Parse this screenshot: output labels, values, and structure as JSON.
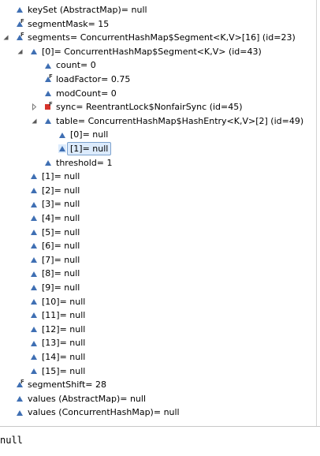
{
  "colors": {
    "field_icon": "#3f6fb3",
    "selection_bg": "#dcebfc",
    "selection_border": "#7da2ce",
    "private_icon": "#d6332b"
  },
  "variables": [
    {
      "label": "keySet (AbstractMap)= null",
      "icon": "field-icon",
      "final": false,
      "twisty": "none"
    },
    {
      "label": "segmentMask= 15",
      "icon": "field-icon",
      "final": true,
      "twisty": "none"
    },
    {
      "label": "segments= ConcurrentHashMap$Segment<K,V>[16]  (id=23)",
      "icon": "field-icon",
      "final": true,
      "twisty": "expanded"
    },
    {
      "label": "[0]= ConcurrentHashMap$Segment<K,V>  (id=43)",
      "icon": "field-icon",
      "final": false,
      "twisty": "expanded"
    },
    {
      "label": "count= 0",
      "icon": "field-icon",
      "final": false,
      "twisty": "none"
    },
    {
      "label": "loadFactor= 0.75",
      "icon": "field-icon",
      "final": true,
      "twisty": "none"
    },
    {
      "label": "modCount= 0",
      "icon": "field-icon",
      "final": false,
      "twisty": "none"
    },
    {
      "label": "sync= ReentrantLock$NonfairSync  (id=45)",
      "icon": "private-field-icon",
      "final": true,
      "twisty": "collapsed"
    },
    {
      "label": "table= ConcurrentHashMap$HashEntry<K,V>[2]  (id=49)",
      "icon": "field-icon",
      "final": false,
      "twisty": "expanded"
    },
    {
      "label": "[0]= null",
      "icon": "field-icon",
      "final": false,
      "twisty": "none"
    },
    {
      "label": "[1]= null",
      "icon": "field-icon",
      "final": false,
      "twisty": "none",
      "selected": true
    },
    {
      "label": "threshold= 1",
      "icon": "field-icon",
      "final": false,
      "twisty": "none"
    },
    {
      "label": "[1]= null",
      "icon": "field-icon",
      "final": false,
      "twisty": "none"
    },
    {
      "label": "[2]= null",
      "icon": "field-icon",
      "final": false,
      "twisty": "none"
    },
    {
      "label": "[3]= null",
      "icon": "field-icon",
      "final": false,
      "twisty": "none"
    },
    {
      "label": "[4]= null",
      "icon": "field-icon",
      "final": false,
      "twisty": "none"
    },
    {
      "label": "[5]= null",
      "icon": "field-icon",
      "final": false,
      "twisty": "none"
    },
    {
      "label": "[6]= null",
      "icon": "field-icon",
      "final": false,
      "twisty": "none"
    },
    {
      "label": "[7]= null",
      "icon": "field-icon",
      "final": false,
      "twisty": "none"
    },
    {
      "label": "[8]= null",
      "icon": "field-icon",
      "final": false,
      "twisty": "none"
    },
    {
      "label": "[9]= null",
      "icon": "field-icon",
      "final": false,
      "twisty": "none"
    },
    {
      "label": "[10]= null",
      "icon": "field-icon",
      "final": false,
      "twisty": "none"
    },
    {
      "label": "[11]= null",
      "icon": "field-icon",
      "final": false,
      "twisty": "none"
    },
    {
      "label": "[12]= null",
      "icon": "field-icon",
      "final": false,
      "twisty": "none"
    },
    {
      "label": "[13]= null",
      "icon": "field-icon",
      "final": false,
      "twisty": "none"
    },
    {
      "label": "[14]= null",
      "icon": "field-icon",
      "final": false,
      "twisty": "none"
    },
    {
      "label": "[15]= null",
      "icon": "field-icon",
      "final": false,
      "twisty": "none"
    },
    {
      "label": "segmentShift= 28",
      "icon": "field-icon",
      "final": true,
      "twisty": "none"
    },
    {
      "label": "values (AbstractMap)= null",
      "icon": "field-icon",
      "final": false,
      "twisty": "none"
    },
    {
      "label": "values (ConcurrentHashMap)= null",
      "icon": "field-icon",
      "final": false,
      "twisty": "none"
    }
  ],
  "final_marker": "F",
  "console": {
    "text": "null"
  }
}
